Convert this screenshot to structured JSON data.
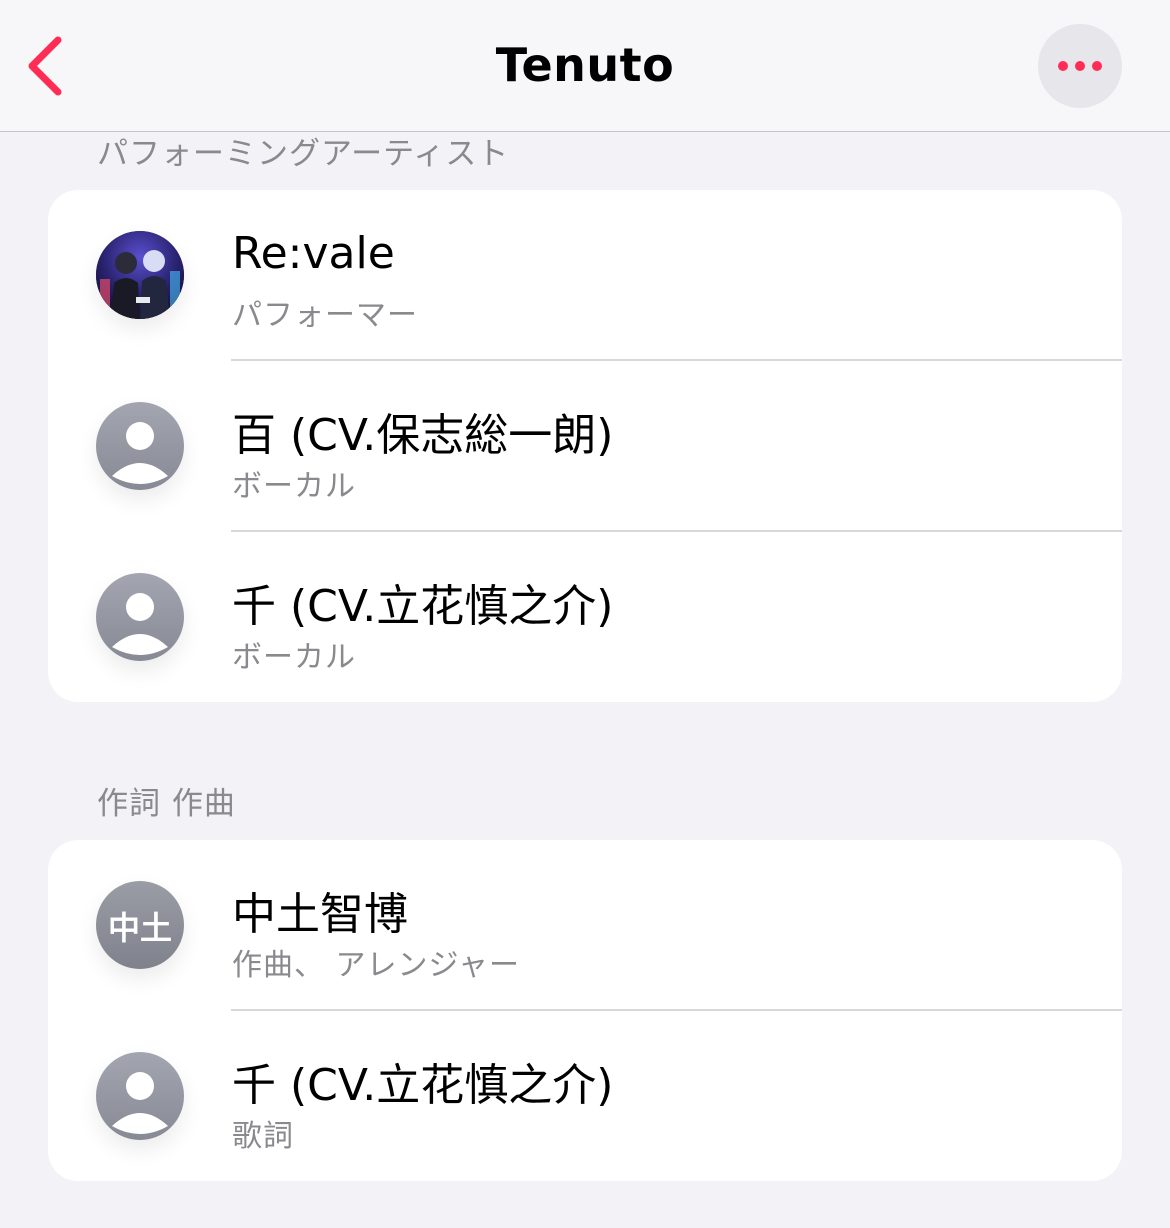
{
  "nav": {
    "title": "Tenuto",
    "back_icon": "chevron-left-icon",
    "more_icon": "ellipsis-icon",
    "accent_color": "#ff2d55"
  },
  "sections": [
    {
      "header": "パフォーミングアーティスト",
      "rows": [
        {
          "name": "Re:vale",
          "role": "パフォーマー",
          "avatar": "artist-artwork"
        },
        {
          "name": "百 (CV.保志総一朗)",
          "role": "ボーカル",
          "avatar": "person-placeholder-icon"
        },
        {
          "name": "千 (CV.立花慎之介)",
          "role": "ボーカル",
          "avatar": "person-placeholder-icon"
        }
      ]
    },
    {
      "header": "作詞 作曲",
      "rows": [
        {
          "name": "中土智博",
          "role": "作曲、 アレンジャー",
          "avatar_initials": "中土"
        },
        {
          "name": "千 (CV.立花慎之介)",
          "role": "歌詞",
          "avatar": "person-placeholder-icon"
        }
      ]
    }
  ]
}
